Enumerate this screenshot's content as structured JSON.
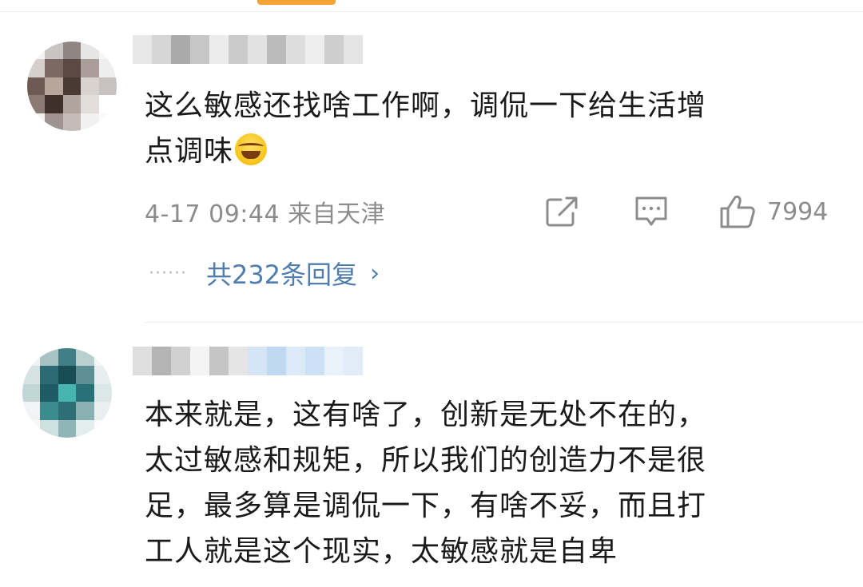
{
  "comments": [
    {
      "text_line1": "这么敏感还找啥工作啊，调侃一下给生活增",
      "text_line2": "点调味",
      "emoji": "laughing-tears-emoji",
      "meta": "4-17 09:44  来自天津",
      "like_count": "7994",
      "replies": {
        "dots": "······",
        "label": "共232条回复",
        "chevron": "›"
      }
    },
    {
      "text_line1": "本来就是，这有啥了，创新是无处不在的，",
      "text_line2": "太过敏感和规矩，所以我们的创造力不是很",
      "text_line3": "足，最多算是调侃一下，有啥不妥，而且打",
      "text_line4": "工人就是这个现实，太敏感就是自卑"
    }
  ],
  "icons": {
    "share": "share-icon",
    "comment": "comment-icon",
    "like": "thumbs-up-icon"
  },
  "colors": {
    "text": "#1a1a1a",
    "meta": "#8c8c8c",
    "link": "#507daf",
    "accent": "#f7a235"
  }
}
